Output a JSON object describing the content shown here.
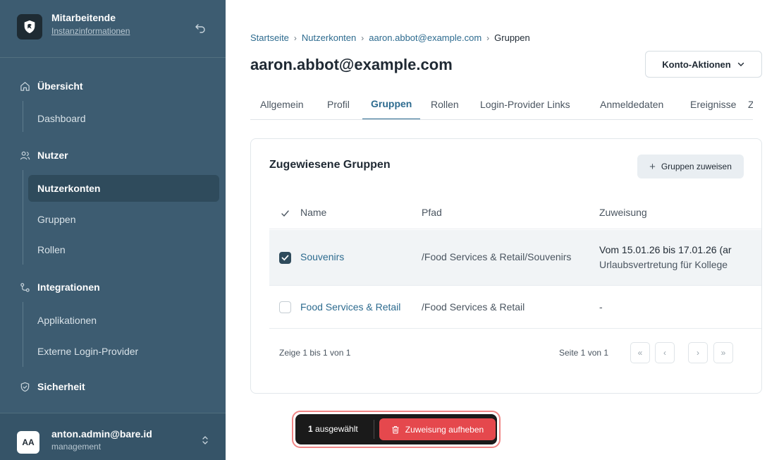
{
  "brand": {
    "title": "Mitarbeitende",
    "subtitle": "Instanzinformationen"
  },
  "sidebar": {
    "sections": [
      {
        "label": "Übersicht",
        "items": [
          "Dashboard"
        ]
      },
      {
        "label": "Nutzer",
        "items": [
          "Nutzerkonten",
          "Gruppen",
          "Rollen"
        ]
      },
      {
        "label": "Integrationen",
        "items": [
          "Applikationen",
          "Externe Login-Provider"
        ]
      },
      {
        "label": "Sicherheit",
        "items": []
      }
    ],
    "active_item": "Nutzerkonten"
  },
  "user": {
    "initials": "AA",
    "email": "anton.admin@bare.id",
    "role": "management"
  },
  "breadcrumb": [
    "Startseite",
    "Nutzerkonten",
    "aaron.abbot@example.com",
    "Gruppen"
  ],
  "page": {
    "title": "aaron.abbot@example.com",
    "actions_label": "Konto-Aktionen"
  },
  "tabs": [
    "Allgemein",
    "Profil",
    "Gruppen",
    "Rollen",
    "Login-Provider Links",
    "Anmeldedaten",
    "Ereignisse",
    "Zu"
  ],
  "active_tab": "Gruppen",
  "card": {
    "title": "Zugewiesene Gruppen",
    "assign_label": "Gruppen zuweisen",
    "columns": [
      "Name",
      "Pfad",
      "Zuweisung"
    ],
    "rows": [
      {
        "name": "Souvenirs",
        "path": "/Food Services & Retail/Souvenirs",
        "assignment": "Vom 15.01.26 bis 17.01.26 (ar",
        "note": "Urlaubsvertretung für Kollege",
        "selected": true
      },
      {
        "name": "Food Services & Retail",
        "path": "/Food Services & Retail",
        "assignment": "-",
        "note": "",
        "selected": false
      }
    ],
    "footer_text": "Zeige 1 bis 1 von 1",
    "page_info": "Seite 1 von 1",
    "pager": [
      "«",
      "‹",
      "›",
      "»"
    ]
  },
  "bulk": {
    "count": "1",
    "count_suffix": " ausgewählt",
    "remove_label": "Zuweisung aufheben"
  },
  "colors": {
    "sidebar": "#3d5c71",
    "accent": "#2d6b8f",
    "danger": "#e5484d"
  }
}
